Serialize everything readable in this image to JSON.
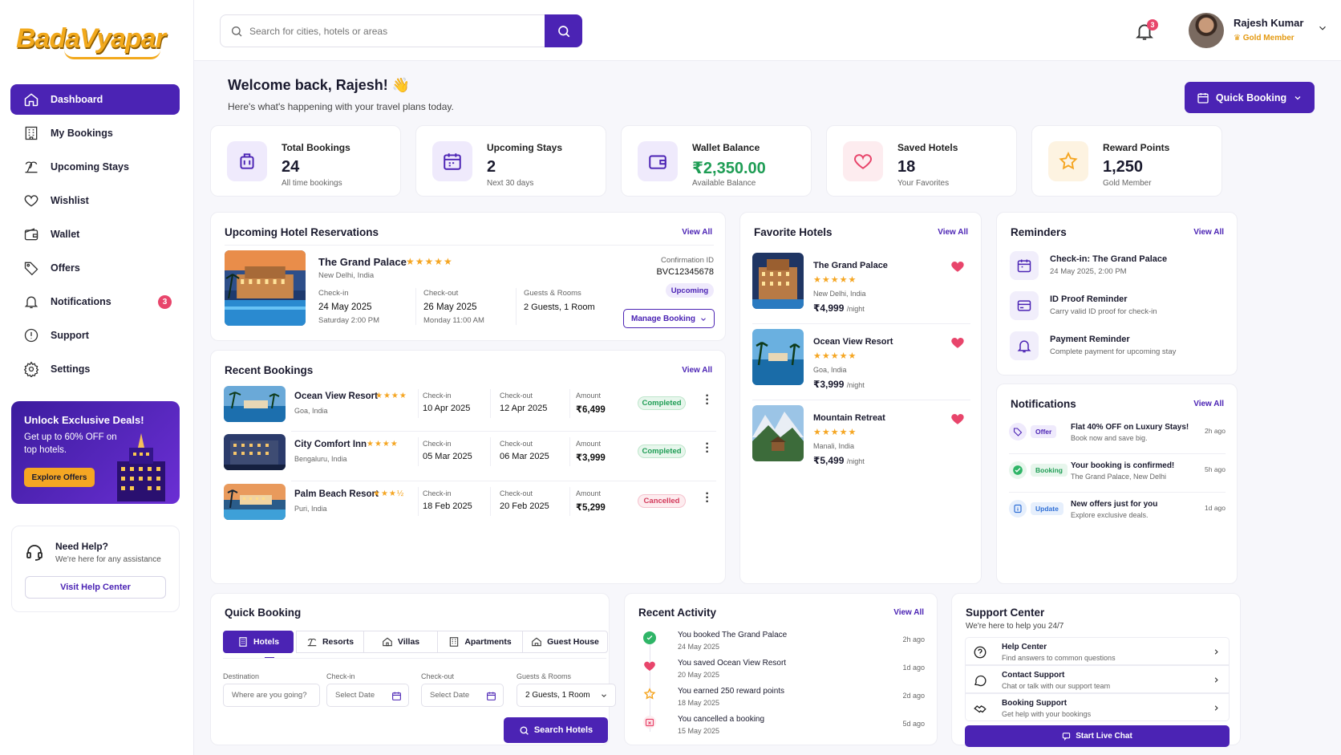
{
  "brand": {
    "logo_text": "BadaVyapar",
    "primary": "#4b23b4",
    "accent": "#f5a623"
  },
  "sidebar": {
    "items": [
      {
        "label": "Dashboard",
        "icon": "home-icon",
        "active": true
      },
      {
        "label": "My Bookings",
        "icon": "building-icon"
      },
      {
        "label": "Upcoming Stays",
        "icon": "beach-icon"
      },
      {
        "label": "Wishlist",
        "icon": "heart-icon"
      },
      {
        "label": "Wallet",
        "icon": "wallet-icon"
      },
      {
        "label": "Offers",
        "icon": "tag-icon"
      },
      {
        "label": "Notifications",
        "icon": "bell-icon",
        "badge": "3"
      },
      {
        "label": "Support",
        "icon": "help-circle-icon"
      },
      {
        "label": "Settings",
        "icon": "gear-icon"
      }
    ],
    "promo": {
      "title": "Unlock Exclusive Deals!",
      "subtitle": "Get up to 60% OFF on top hotels.",
      "button": "Explore Offers"
    },
    "help": {
      "title": "Need Help?",
      "subtitle": "We're here for any assistance",
      "button": "Visit Help Center"
    }
  },
  "topbar": {
    "search_placeholder": "Search for cities, hotels or areas",
    "notification_count": "3",
    "user": {
      "name": "Rajesh Kumar",
      "tier": "Gold Member"
    }
  },
  "header": {
    "welcome": "Welcome back, Rajesh! 👋",
    "subtitle": "Here's what's happening with your travel plans today.",
    "quick_booking": "Quick Booking"
  },
  "stats": [
    {
      "label": "Total Bookings",
      "value": "24",
      "sub": "All time bookings",
      "icon": "suitcase-icon",
      "color": "#4b23b4",
      "bg": "#efeafc"
    },
    {
      "label": "Upcoming Stays",
      "value": "2",
      "sub": "Next 30 days",
      "icon": "calendar-icon",
      "color": "#4b23b4",
      "bg": "#efeafc"
    },
    {
      "label": "Wallet Balance",
      "value": "₹2,350.00",
      "sub": "Available Balance",
      "icon": "wallet-icon",
      "color": "#1f9d55",
      "bg": "#efeafc"
    },
    {
      "label": "Saved Hotels",
      "value": "18",
      "sub": "Your Favorites",
      "icon": "heart-icon",
      "color": "#e8456b",
      "bg": "#fdecef"
    },
    {
      "label": "Reward Points",
      "value": "1,250",
      "sub": "Gold Member",
      "icon": "star-icon",
      "color": "#f5a623",
      "bg": "#fdf3e1"
    }
  ],
  "upcoming": {
    "title": "Upcoming Hotel Reservations",
    "view_all": "View All",
    "hotel": "The Grand Palace",
    "location": "New Delhi, India",
    "checkin_label": "Check-in",
    "checkin": "24 May 2025",
    "checkin_time": "Saturday 2:00 PM",
    "checkout_label": "Check-out",
    "checkout": "26 May 2025",
    "checkout_time": "Monday 11:00 AM",
    "guests_label": "Guests & Rooms",
    "guests": "2 Guests, 1 Room",
    "conf_label": "Confirmation ID",
    "conf_id": "BVC12345678",
    "status": "Upcoming",
    "manage": "Manage Booking"
  },
  "recent": {
    "title": "Recent Bookings",
    "view_all": "View All",
    "checkin_label": "Check-in",
    "checkout_label": "Check-out",
    "amount_label": "Amount",
    "rows": [
      {
        "hotel": "Ocean View Resort",
        "stars": "★★★★",
        "location": "Goa, India",
        "checkin": "10 Apr 2025",
        "checkout": "12 Apr 2025",
        "amount": "₹6,499",
        "status": "Completed"
      },
      {
        "hotel": "City Comfort Inn",
        "stars": "★★★★",
        "location": "Bengaluru, India",
        "checkin": "05 Mar 2025",
        "checkout": "06 Mar 2025",
        "amount": "₹3,999",
        "status": "Completed"
      },
      {
        "hotel": "Palm Beach Resort",
        "stars": "★★★½",
        "location": "Puri, India",
        "checkin": "18 Feb 2025",
        "checkout": "20 Feb 2025",
        "amount": "₹5,299",
        "status": "Cancelled"
      }
    ]
  },
  "favorites": {
    "title": "Favorite Hotels",
    "view_all": "View All",
    "per_night": "/night",
    "items": [
      {
        "hotel": "The Grand Palace",
        "location": "New Delhi, India",
        "price": "₹4,999"
      },
      {
        "hotel": "Ocean View Resort",
        "location": "Goa, India",
        "price": "₹3,999"
      },
      {
        "hotel": "Mountain Retreat",
        "location": "Manali, India",
        "price": "₹5,499"
      }
    ]
  },
  "reminders": {
    "title": "Reminders",
    "view_all": "View All",
    "items": [
      {
        "title": "Check-in: The Grand Palace",
        "sub": "24 May 2025, 2:00 PM",
        "icon": "calendar-icon"
      },
      {
        "title": "ID Proof Reminder",
        "sub": "Carry valid ID proof for check-in",
        "icon": "id-card-icon"
      },
      {
        "title": "Payment Reminder",
        "sub": "Complete payment for upcoming stay",
        "icon": "bell-icon"
      }
    ]
  },
  "notifications": {
    "title": "Notifications",
    "view_all": "View All",
    "items": [
      {
        "tag": "Offer",
        "title": "Flat 40% OFF on Luxury Stays!",
        "sub": "Book now and save big.",
        "time": "2h ago"
      },
      {
        "tag": "Booking",
        "title": "Your booking is confirmed!",
        "sub": "The Grand Palace, New Delhi",
        "time": "5h ago"
      },
      {
        "tag": "Update",
        "title": "New offers just for you",
        "sub": "Explore exclusive deals.",
        "time": "1d ago"
      }
    ]
  },
  "quick": {
    "title": "Quick Booking",
    "tabs": [
      "Hotels",
      "Resorts",
      "Villas",
      "Apartments",
      "Guest House"
    ],
    "destination_label": "Destination",
    "destination_placeholder": "Where are you going?",
    "checkin_label": "Check-in",
    "checkout_label": "Check-out",
    "date_placeholder": "Select Date",
    "guests_label": "Guests & Rooms",
    "guests_value": "2 Guests, 1 Room",
    "search": "Search Hotels"
  },
  "activity": {
    "title": "Recent Activity",
    "view_all": "View All",
    "items": [
      {
        "title": "You booked The Grand Palace",
        "date": "24 May 2025",
        "time": "2h ago"
      },
      {
        "title": "You saved Ocean View Resort",
        "date": "20 May 2025",
        "time": "1d ago"
      },
      {
        "title": "You earned 250 reward points",
        "date": "18 May 2025",
        "time": "2d ago"
      },
      {
        "title": "You cancelled a booking",
        "date": "15 May 2025",
        "time": "5d ago"
      }
    ]
  },
  "support": {
    "title": "Support Center",
    "subtitle": "We're here to help you 24/7",
    "items": [
      {
        "title": "Help Center",
        "sub": "Find answers to common questions"
      },
      {
        "title": "Contact Support",
        "sub": "Chat or talk with our support team"
      },
      {
        "title": "Booking Support",
        "sub": "Get help with your bookings"
      }
    ],
    "chat": "Start Live Chat"
  }
}
